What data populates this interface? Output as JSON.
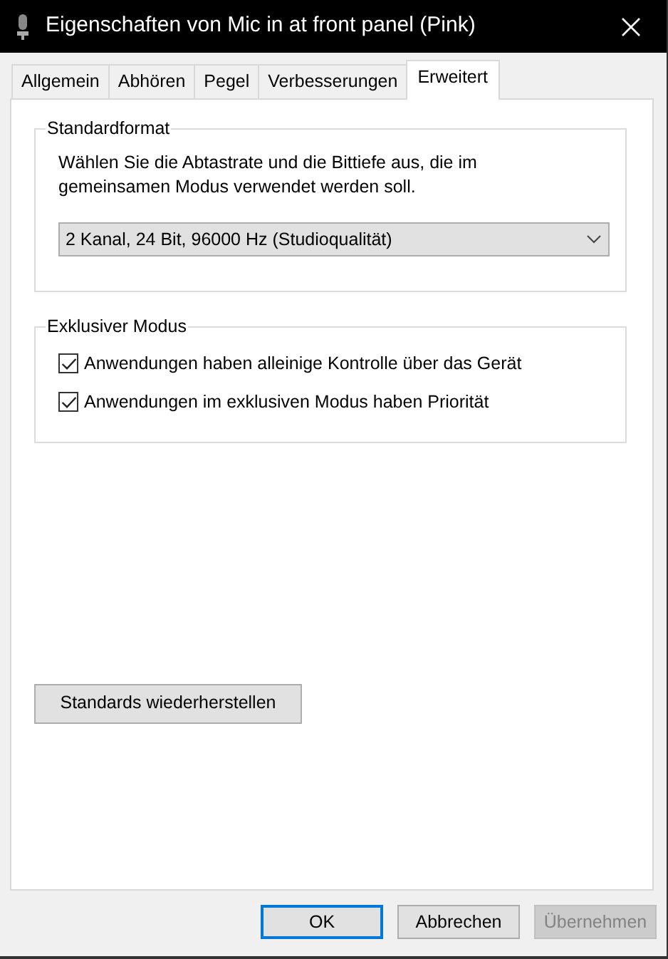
{
  "window": {
    "title": "Eigenschaften von Mic in at front panel (Pink)"
  },
  "tabs": [
    {
      "label": "Allgemein",
      "selected": false
    },
    {
      "label": "Abhören",
      "selected": false
    },
    {
      "label": "Pegel",
      "selected": false
    },
    {
      "label": "Verbesserungen",
      "selected": false
    },
    {
      "label": "Erweitert",
      "selected": true
    }
  ],
  "groups": [
    {
      "kind": "format",
      "legend": "Standardformat",
      "description": "Wählen Sie die Abtastrate und die Bittiefe aus, die im gemeinsamen Modus verwendet werden soll.",
      "select": {
        "value": "2 Kanal, 24 Bit, 96000 Hz (Studioqualität)"
      }
    },
    {
      "kind": "checks",
      "legend": "Exklusiver Modus",
      "options": [
        {
          "label": "Anwendungen haben alleinige Kontrolle über das Gerät",
          "checked": true
        },
        {
          "label": "Anwendungen im exklusiven Modus haben Priorität",
          "checked": true
        }
      ]
    }
  ],
  "restore_button": {
    "label": "Standards wiederherstellen"
  },
  "buttons": [
    {
      "label": "OK",
      "default": true,
      "disabled": false
    },
    {
      "label": "Abbrechen",
      "default": false,
      "disabled": false
    },
    {
      "label": "Übernehmen",
      "default": false,
      "disabled": true
    }
  ]
}
